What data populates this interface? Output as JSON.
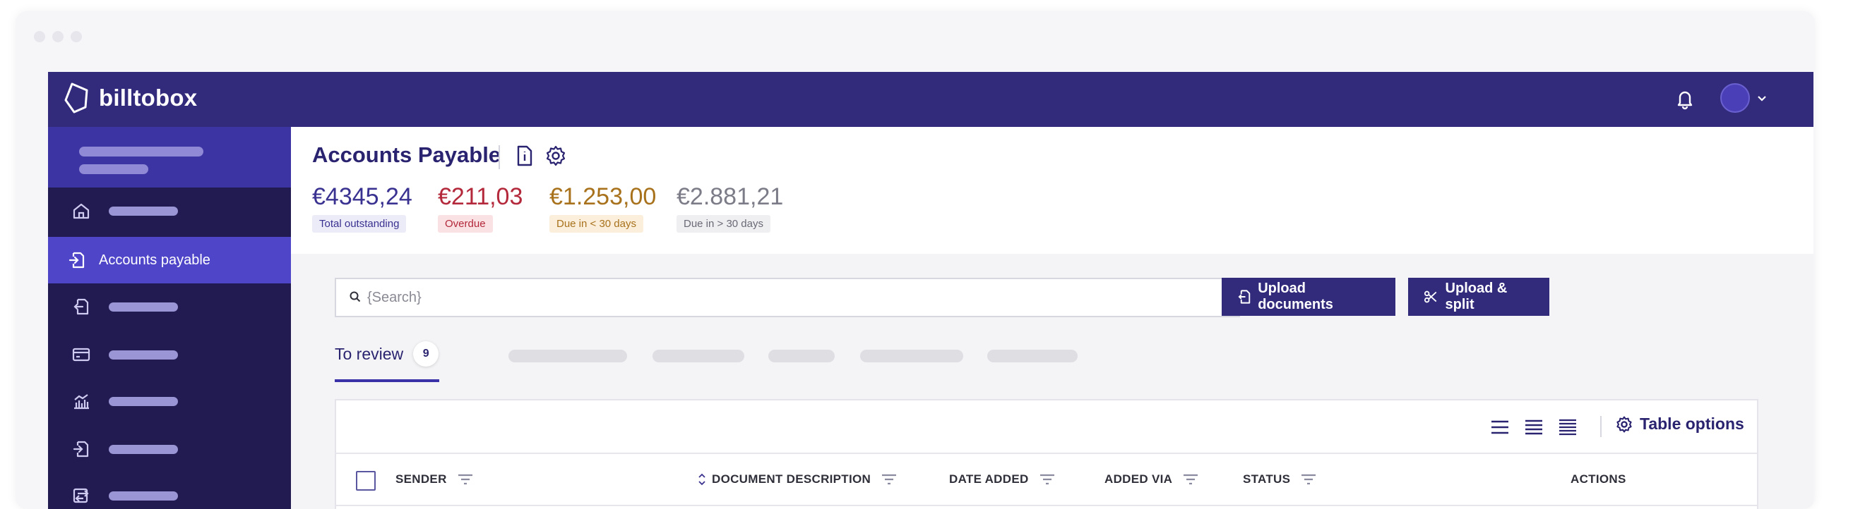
{
  "app": {
    "brand": "billtobox"
  },
  "sidebar": {
    "active_item": {
      "label": "Accounts payable"
    },
    "items": [
      {
        "icon": "home-icon"
      },
      {
        "icon": "accounts-payable-icon",
        "label": "Accounts payable"
      },
      {
        "icon": "document-out-icon"
      },
      {
        "icon": "credit-card-icon"
      },
      {
        "icon": "chart-icon"
      },
      {
        "icon": "document-in-icon"
      },
      {
        "icon": "transfer-icon"
      }
    ]
  },
  "header": {
    "title": "Accounts Payable"
  },
  "stats": [
    {
      "value": "€4345,24",
      "label": "Total outstanding",
      "color": "#3a3290",
      "badge_bg": "#ecebf8"
    },
    {
      "value": "€211,03",
      "label": "Overdue",
      "color": "#b3283a",
      "badge_bg": "#f9e1e4"
    },
    {
      "value": "€1.253,00",
      "label": "Due in < 30 days",
      "color": "#a8721c",
      "badge_bg": "#fbeedb"
    },
    {
      "value": "€2.881,21",
      "label": "Due in > 30 days",
      "color": "#7c7c88",
      "badge_bg": "#efeff2"
    }
  ],
  "search": {
    "placeholder": "{Search}"
  },
  "buttons": {
    "upload_documents": "Upload documents",
    "upload_split": "Upload & split"
  },
  "tabs": {
    "active": {
      "label": "To review",
      "count": "9"
    }
  },
  "table": {
    "options_label": "Table options",
    "columns": {
      "sender": "SENDER",
      "document_description": "DOCUMENT DESCRIPTION",
      "date_added": "DATE ADDED",
      "added_via": "ADDED VIA",
      "status": "STATUS",
      "actions": "ACTIONS"
    }
  },
  "colors": {
    "brand": "#322b7c",
    "sidebar": "#211b52",
    "sidebar_active": "#4f45c8"
  }
}
